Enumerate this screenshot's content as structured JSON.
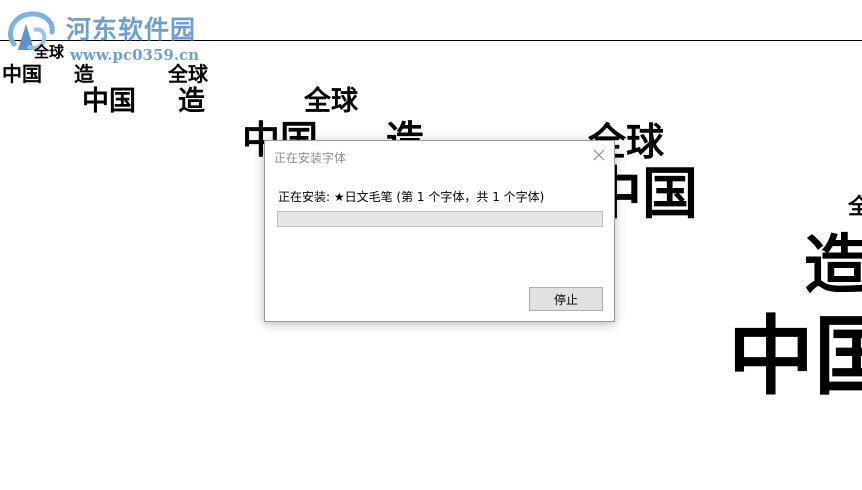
{
  "watermark": {
    "site_name": "河东软件园",
    "url": "www.pc0359.cn",
    "color": "#6f9fd0"
  },
  "preview": {
    "word_zhongguo": "中国",
    "word_zao": "造",
    "word_quanqiu": "全球"
  },
  "dialog": {
    "title": "正在安装字体",
    "status_text": "正在安装: ★日文毛笔 (第 1 个字体，共 1 个字体)",
    "progress_fraction": 0,
    "stop_label": "停止",
    "close_icon": "close-icon"
  }
}
